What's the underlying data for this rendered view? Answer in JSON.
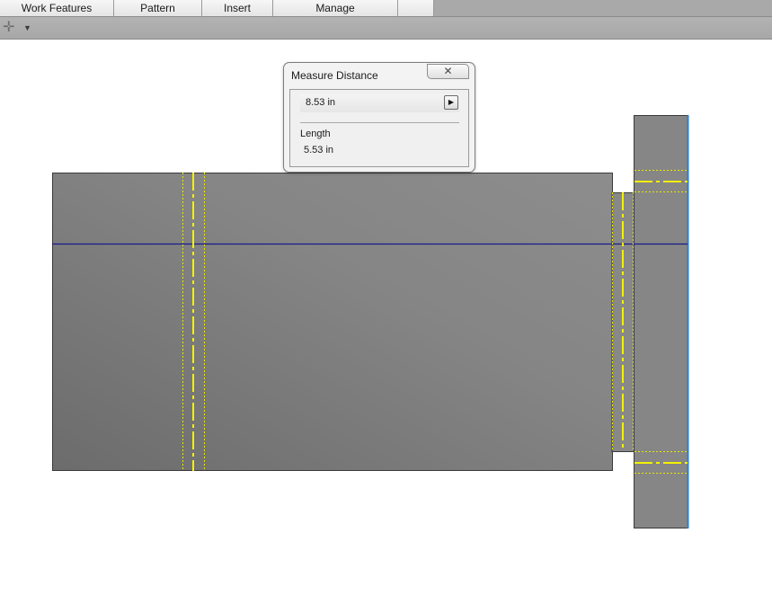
{
  "ribbon": {
    "tabs": [
      "Work Features",
      "Pattern",
      "Insert",
      "Manage",
      ""
    ]
  },
  "toolbar": {
    "plus_icon": "quick-access-plus-icon",
    "dropdown_icon": "dropdown-arrow-icon"
  },
  "measure_dialog": {
    "title": "Measure Distance",
    "close_icon": "close-icon",
    "distance_value": "8.53 in",
    "expand_icon": "play-arrow-icon",
    "length_label": "Length",
    "length_value": "5.53 in"
  },
  "colors": {
    "part_body": "#7f7f7f",
    "centerline_yellow": "#f2f200",
    "axis_line": "#1a1a8c",
    "edge_highlight": "#2a7fd4"
  }
}
